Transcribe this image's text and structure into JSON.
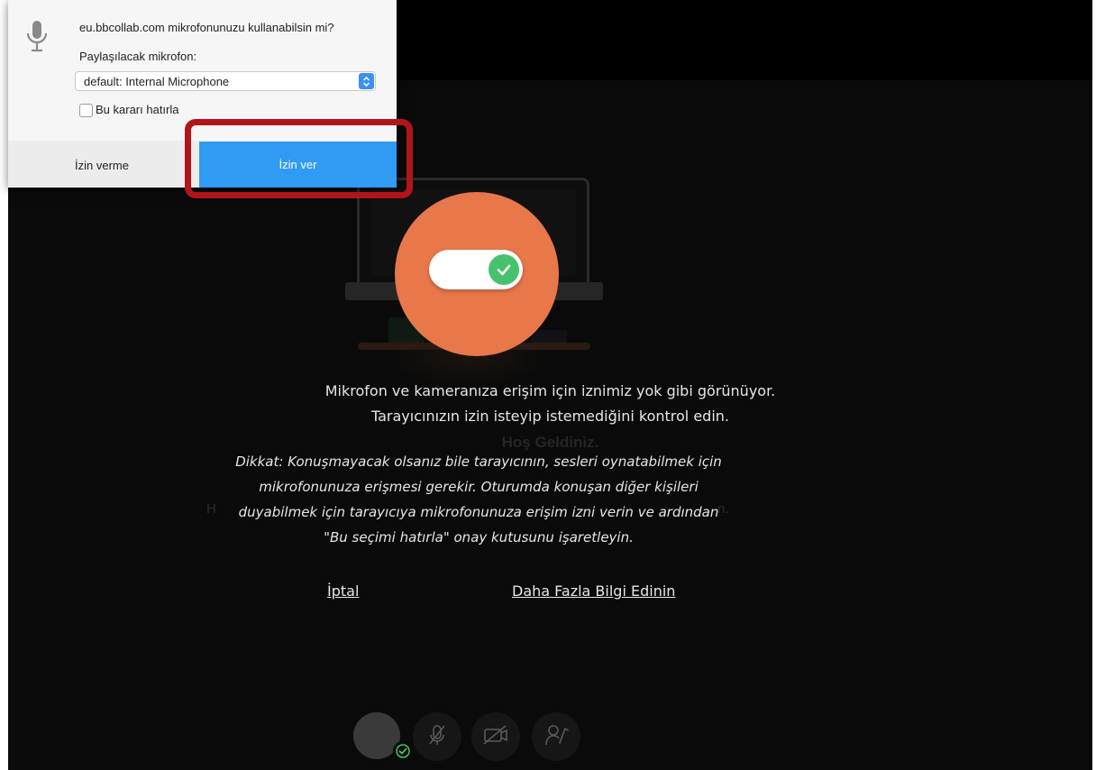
{
  "permission_prompt": {
    "title": "eu.bbcollab.com mikrofonunuzu kullanabilsin mi?",
    "share_label": "Paylaşılacak mikrofon:",
    "selected_microphone": "default: Internal Microphone",
    "remember_label": "Bu kararı hatırla",
    "remember_checked": false,
    "deny_label": "İzin verme",
    "allow_label": "İzin ver"
  },
  "background": {
    "welcome_title": "Hoş Geldiniz.",
    "sub_left": "H",
    "sub_right": "n."
  },
  "main": {
    "message_line1": "Mikrofon ve kameranıza erişim için iznimiz yok gibi görünüyor.",
    "message_line2": "Tarayıcınızın izin isteyip istemediğini kontrol edin.",
    "note_line1": "Dikkat: Konuşmayacak olsanız bile tarayıcının, sesleri oynatabilmek için",
    "note_line2": "mikrofonunuza erişmesi gerekir. Oturumda konuşan diğer kişileri",
    "note_line3": "duyabilmek için tarayıcıya mikrofonunuza erişim izni verin ve ardından",
    "note_line4": "\"Bu seçimi hatırla\" onay kutusunu işaretleyin.",
    "cancel_link": "İptal",
    "more_info_link": "Daha Fazla Bilgi Edinin"
  },
  "colors": {
    "accent_orange": "#e8774a",
    "allow_blue": "#2f9bf2",
    "highlight_red": "#b2141c",
    "check_green": "#46c26d"
  },
  "icons": [
    "microphone-icon",
    "select-arrows-icon",
    "check-icon",
    "mic-muted-icon",
    "camera-off-icon",
    "raise-hand-icon"
  ]
}
